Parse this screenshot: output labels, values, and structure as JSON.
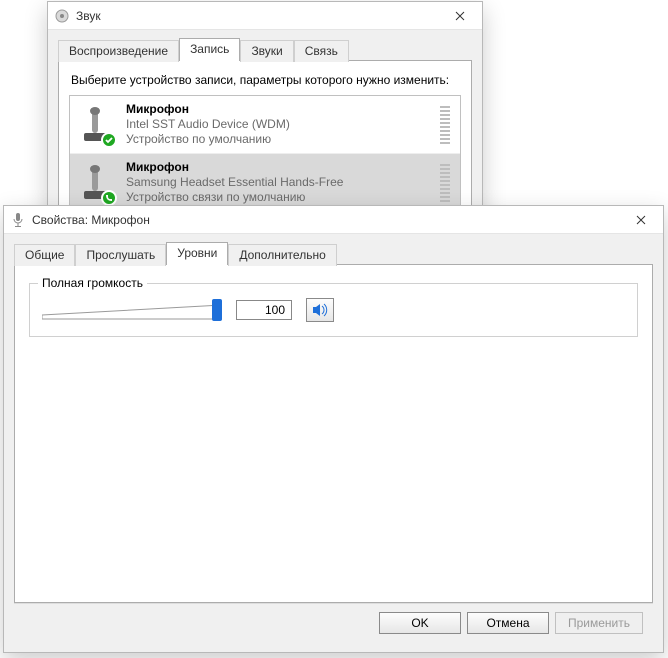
{
  "sound_window": {
    "title": "Звук",
    "tabs": [
      "Воспроизведение",
      "Запись",
      "Звуки",
      "Связь"
    ],
    "active_tab_index": 1,
    "instruction": "Выберите устройство записи, параметры которого нужно изменить:",
    "devices": [
      {
        "name": "Микрофон",
        "subtitle": "Intel SST Audio Device (WDM)",
        "default_text": "Устройство по умолчанию",
        "badge": "check",
        "selected": false
      },
      {
        "name": "Микрофон",
        "subtitle": "Samsung Headset Essential Hands-Free",
        "default_text": "Устройство связи по умолчанию",
        "badge": "phone",
        "selected": true
      }
    ]
  },
  "props_window": {
    "title": "Свойства: Микрофон",
    "tabs": [
      "Общие",
      "Прослушать",
      "Уровни",
      "Дополнительно"
    ],
    "active_tab_index": 2,
    "volume_group": {
      "label": "Полная громкость",
      "value": "100",
      "slider_percent": 100,
      "mute_icon": "speaker-icon"
    },
    "buttons": {
      "ok": "OK",
      "cancel": "Отмена",
      "apply": "Применить"
    }
  }
}
